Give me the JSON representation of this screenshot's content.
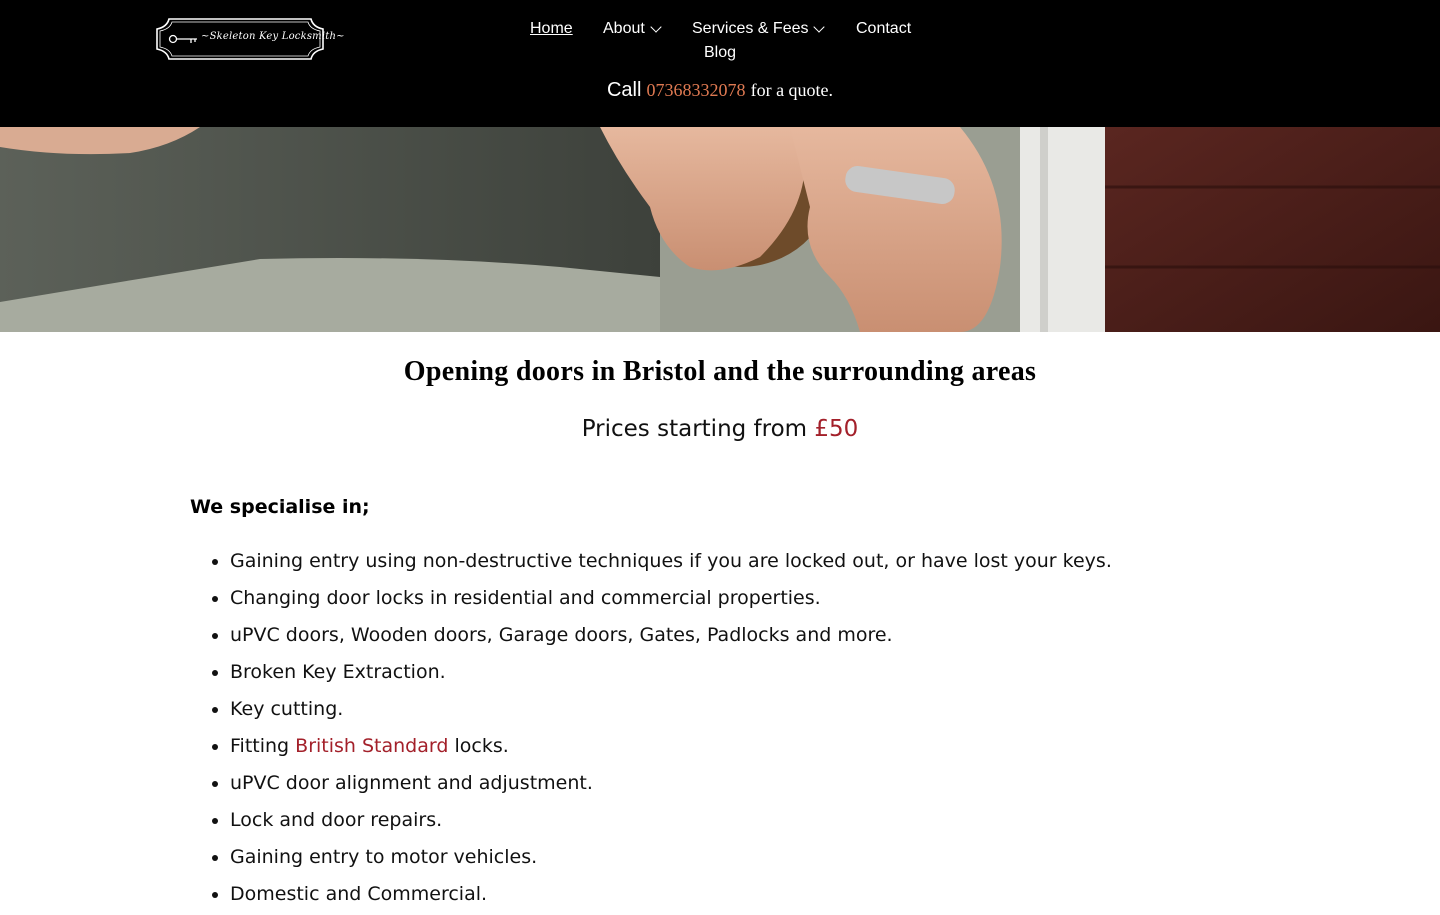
{
  "header": {
    "logo_text": "~Skeleton Key Locksmith~",
    "nav": [
      {
        "label": "Home",
        "active": true
      },
      {
        "label": "About",
        "dropdown": true
      },
      {
        "label": "Services & Fees",
        "dropdown": true
      },
      {
        "label": "Contact"
      },
      {
        "label": "Blog"
      }
    ],
    "call": {
      "prefix": "Call",
      "phone": "07368332078",
      "suffix": "for a quote."
    }
  },
  "hero": {
    "image": "hands-picking-door-lock-photo"
  },
  "main": {
    "headline": "Opening doors in Bristol and the surrounding areas",
    "prices_prefix": "Prices starting from",
    "prices_value": "£50",
    "specialise_heading": "We specialise in;",
    "services": [
      "Gaining entry using non-destructive techniques if you are locked out, or have lost your keys.",
      "Changing door locks in residential and commercial properties.",
      "uPVC doors, Wooden doors, Garage doors, Gates, Padlocks and more.",
      "Broken Key Extraction.",
      "Key cutting.",
      {
        "before": "Fitting",
        "link": "British Standard",
        "after": "locks."
      },
      "uPVC door alignment and adjustment.",
      "Lock and door repairs.",
      "Gaining entry to motor vehicles.",
      "Domestic and Commercial."
    ]
  },
  "colors": {
    "header_bg": "#000000",
    "accent_red": "#a3202a",
    "phone_orange": "#e07a52"
  }
}
